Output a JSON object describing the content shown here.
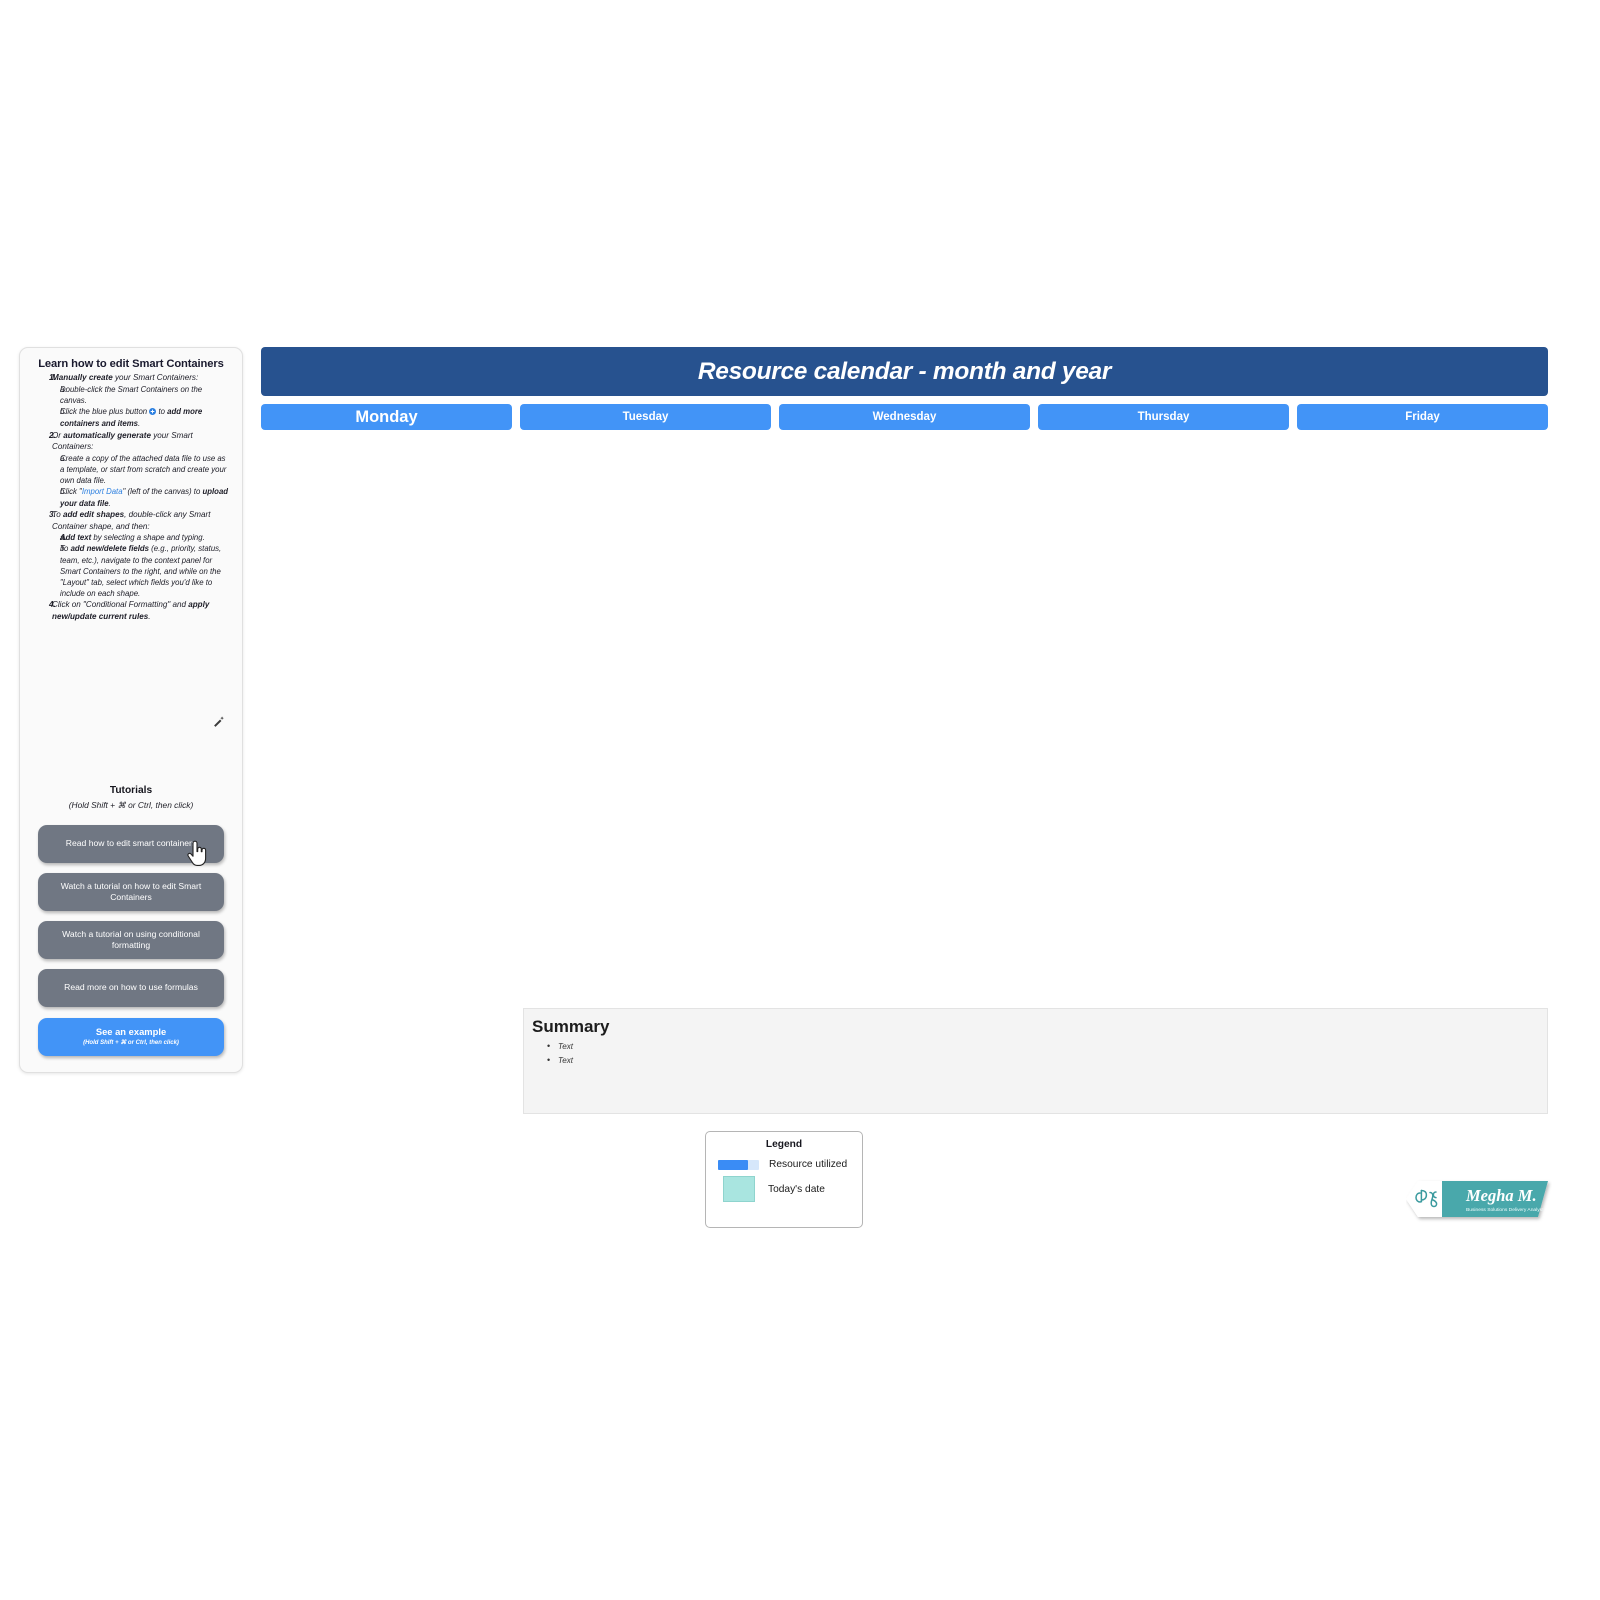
{
  "instructions": {
    "title": "Learn how to edit Smart Containers",
    "items": [
      {
        "num": "1.",
        "html_key": "i1"
      },
      {
        "num": "a.",
        "html_key": "i1a"
      },
      {
        "num": "b.",
        "html_key": "i1b"
      },
      {
        "num": "2.",
        "html_key": "i2"
      },
      {
        "num": "a.",
        "html_key": "i2a"
      },
      {
        "num": "b.",
        "html_key": "i2b"
      },
      {
        "num": "3.",
        "html_key": "i3"
      },
      {
        "num": "a.",
        "html_key": "i3a"
      },
      {
        "num": "b.",
        "html_key": "i3b"
      },
      {
        "num": "4.",
        "html_key": "i4"
      }
    ],
    "i1_strong": "Manually create",
    "i1_rest": " your Smart Containers:",
    "i1a": "Double-click the Smart Containers on the canvas.",
    "i1b_pre": "Click the blue plus button",
    "i1b_mid": "to",
    "i1b_strong": "add more containers and items",
    "i1b_end": ".",
    "i2_pre": "Or ",
    "i2_strong": "automatically generate",
    "i2_rest": " your Smart Containers:",
    "i2a": "Create a copy of the attached data file to use as a template, or start from scratch and create your own data file.",
    "i2b_pre": "Click \"",
    "i2b_link": "Import Data",
    "i2b_mid": "\" (left of the canvas) to ",
    "i2b_strong": "upload your data file",
    "i2b_end": ".",
    "i3_pre": "To ",
    "i3_strong": "add edit shapes",
    "i3_rest": ", double-click any Smart Container shape, and then:",
    "i3a_strong": "Add text",
    "i3a_rest": " by selecting a shape and typing.",
    "i3b_pre": "To ",
    "i3b_strong": "add new/delete fields",
    "i3b_rest": " (e.g., priority, status, team, etc.), navigate to the context panel for Smart Containers to the right, and while on the \"Layout\" tab, select which fields you'd like to include on each shape.",
    "i4_pre": "Click on \"Conditional Formatting\" and ",
    "i4_strong": "apply new/update current rules",
    "i4_end": "."
  },
  "tutorials": {
    "title": "Tutorials",
    "subtitle": "(Hold Shift + ⌘ or Ctrl, then click)",
    "buttons": [
      {
        "label": "Read how to edit smart containers"
      },
      {
        "label": "Watch a tutorial on how to edit Smart Containers"
      },
      {
        "label": "Watch a tutorial on using conditional formatting"
      },
      {
        "label": "Read more on how to use formulas"
      }
    ],
    "example_button": {
      "label": "See an example",
      "sublabel": "(Hold Shift + ⌘ or Ctrl, then click)"
    }
  },
  "calendar": {
    "title": "Resource calendar - month and year",
    "days": [
      {
        "label": "Monday"
      },
      {
        "label": "Tuesday"
      },
      {
        "label": "Wednesday"
      },
      {
        "label": "Thursday"
      },
      {
        "label": "Friday"
      }
    ]
  },
  "summary": {
    "title": "Summary",
    "bullets": [
      {
        "text": "Text"
      },
      {
        "text": "Text"
      }
    ]
  },
  "legend": {
    "title": "Legend",
    "entries": [
      {
        "label": "Resource utilized",
        "swatch": "bar",
        "color": "#3a8cf5",
        "track_color": "#d6e7fb"
      },
      {
        "label": "Today's date",
        "swatch": "square",
        "color": "#a9e5e0"
      }
    ]
  },
  "logo": {
    "name": "Megha M.",
    "tagline": "Business Solutions Delivery Analyst",
    "accent": "#4aa8ab"
  },
  "colors": {
    "header_blue": "#27528f",
    "day_blue": "#4294f7",
    "button_gray": "#707783",
    "link_blue": "#2b7fe0"
  }
}
